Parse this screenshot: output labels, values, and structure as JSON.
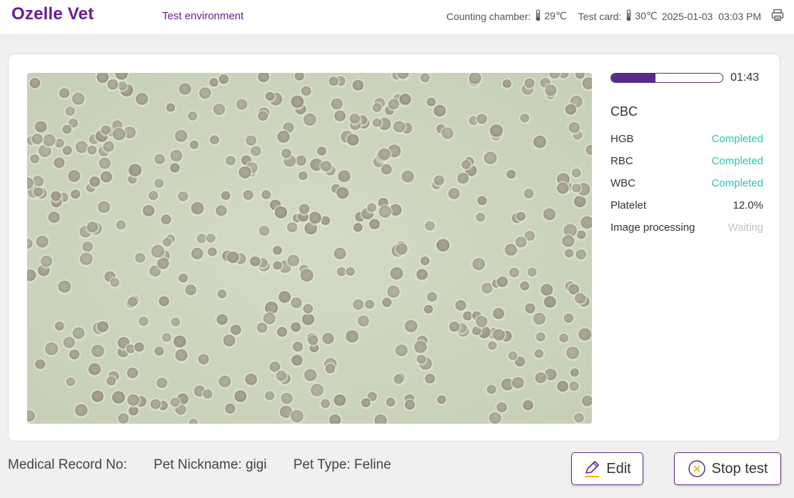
{
  "header": {
    "logo": "Ozelle Vet",
    "environment": "Test environment",
    "counting_chamber_label": "Counting chamber:",
    "counting_chamber_temp": "29℃",
    "test_card_label": "Test card:",
    "test_card_temp": "30℃",
    "datetime": "2025-01-03  03:03 PM"
  },
  "analysis": {
    "progress": 0.4,
    "timer": "01:43",
    "title": "CBC",
    "items": [
      {
        "name": "HGB",
        "status": "Completed",
        "state": "done"
      },
      {
        "name": "RBC",
        "status": "Completed",
        "state": "done"
      },
      {
        "name": "WBC",
        "status": "Completed",
        "state": "done"
      },
      {
        "name": "Platelet",
        "status": "12.0%",
        "state": "progress"
      },
      {
        "name": "Image processing",
        "status": "Waiting",
        "state": "wait"
      }
    ]
  },
  "footer": {
    "medical_record": "Medical Record No:",
    "pet_nickname": "Pet Nickname: gigi",
    "pet_type": "Pet Type: Feline",
    "edit_label": "Edit",
    "stop_label": "Stop test"
  },
  "colors": {
    "brand": "#6a1b9a",
    "accent": "#5b2c83",
    "completed": "#2ec4b6",
    "waiting": "#c2c2c2"
  },
  "icons": [
    "thermometer-icon",
    "printer-icon",
    "pencil-icon",
    "close-circle-icon"
  ]
}
